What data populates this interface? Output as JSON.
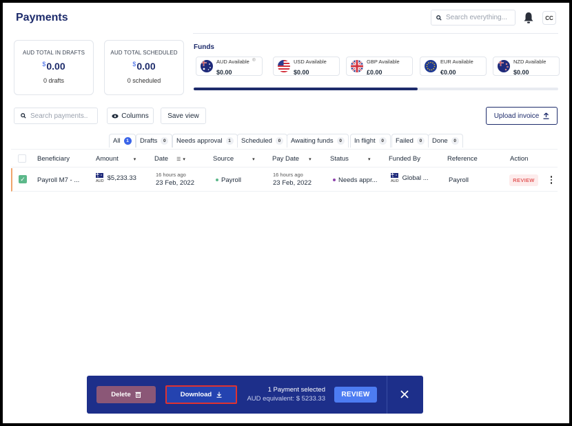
{
  "header": {
    "title": "Payments",
    "search_placeholder": "Search everything...",
    "avatar_initials": "CC"
  },
  "totals": [
    {
      "label": "AUD TOTAL IN DRAFTS",
      "currency_symbol": "$",
      "amount": "0.00",
      "sub": "0 drafts"
    },
    {
      "label": "AUD TOTAL SCHEDULED",
      "currency_symbol": "$",
      "amount": "0.00",
      "sub": "0 scheduled"
    }
  ],
  "funds": {
    "title": "Funds",
    "scroll_position_fraction": 0.62,
    "items": [
      {
        "name": "AUD Available",
        "value": "$0.00",
        "flag": "australia-flag-icon",
        "info": "®"
      },
      {
        "name": "USD Available",
        "value": "$0.00",
        "flag": "usa-flag-icon"
      },
      {
        "name": "GBP Available",
        "value": "£0.00",
        "flag": "uk-flag-icon"
      },
      {
        "name": "EUR Available",
        "value": "€0.00",
        "flag": "eu-flag-icon"
      },
      {
        "name": "NZD Available",
        "value": "$0.00",
        "flag": "nz-flag-icon"
      }
    ]
  },
  "toolbar": {
    "search_placeholder": "Search payments..",
    "columns_label": "Columns",
    "save_view_label": "Save view",
    "upload_label": "Upload invoice"
  },
  "tabs": [
    {
      "label": "All",
      "count": "1",
      "active": true
    },
    {
      "label": "Drafts",
      "count": "0"
    },
    {
      "label": "Needs approval",
      "count": "1"
    },
    {
      "label": "Scheduled",
      "count": "0"
    },
    {
      "label": "Awaiting funds",
      "count": "0"
    },
    {
      "label": "In flight",
      "count": "0"
    },
    {
      "label": "Failed",
      "count": "0"
    },
    {
      "label": "Done",
      "count": "0"
    }
  ],
  "table": {
    "columns": [
      "Beneficiary",
      "Amount",
      "Date",
      "Source",
      "Pay Date",
      "Status",
      "Funded By",
      "Reference",
      "Action"
    ],
    "rows": [
      {
        "beneficiary": "Payroll M7 - ...",
        "amount_currency": "AUD",
        "amount": "$5,233.33",
        "date_relative": "16 hours ago",
        "date": "23 Feb, 2022",
        "source": "Payroll",
        "pay_date_relative": "16 hours ago",
        "pay_date": "23 Feb, 2022",
        "status": "Needs appr...",
        "funded_by_currency": "AUD",
        "funded_by": "Global ...",
        "reference": "Payroll",
        "action": "REVIEW"
      }
    ]
  },
  "action_bar": {
    "delete_label": "Delete",
    "download_label": "Download",
    "selected_text": "1 Payment selected",
    "equivalent_text": "AUD equivalent: $ 5233.33",
    "review_label": "REVIEW"
  },
  "colors": {
    "brand_navy": "#1d2b6b",
    "action_bar": "#1d2f8a",
    "accent_blue": "#3a64e8",
    "highlight_red": "#e0322f",
    "status_purple": "#8e44ad",
    "source_green": "#5cb88a"
  }
}
